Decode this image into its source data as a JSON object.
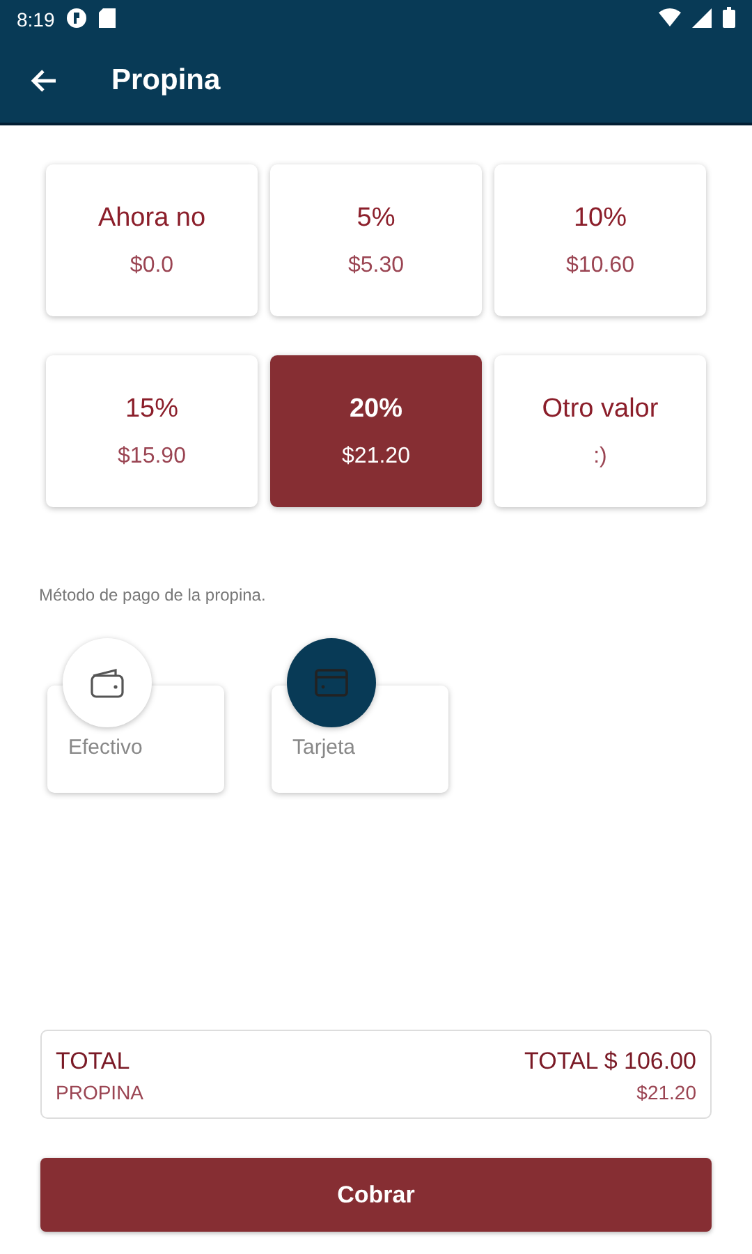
{
  "status_bar": {
    "time": "8:19"
  },
  "app_bar": {
    "title": "Propina"
  },
  "tip_options": [
    {
      "label": "Ahora no",
      "amount": "$0.0",
      "selected": false
    },
    {
      "label": "5%",
      "amount": "$5.30",
      "selected": false
    },
    {
      "label": "10%",
      "amount": "$10.60",
      "selected": false
    },
    {
      "label": "15%",
      "amount": "$15.90",
      "selected": false
    },
    {
      "label": "20%",
      "amount": "$21.20",
      "selected": true
    },
    {
      "label": "Otro valor",
      "amount": ":)",
      "selected": false
    }
  ],
  "payment_label": "Método de pago de la propina.",
  "payment_methods": [
    {
      "label": "Efectivo",
      "kind": "cash",
      "selected": false
    },
    {
      "label": "Tarjeta",
      "kind": "card",
      "selected": true
    }
  ],
  "summary": {
    "total_label": "TOTAL",
    "total_value": "TOTAL $ 106.00",
    "tip_label": "PROPINA",
    "tip_value": "$21.20"
  },
  "charge_button": "Cobrar"
}
